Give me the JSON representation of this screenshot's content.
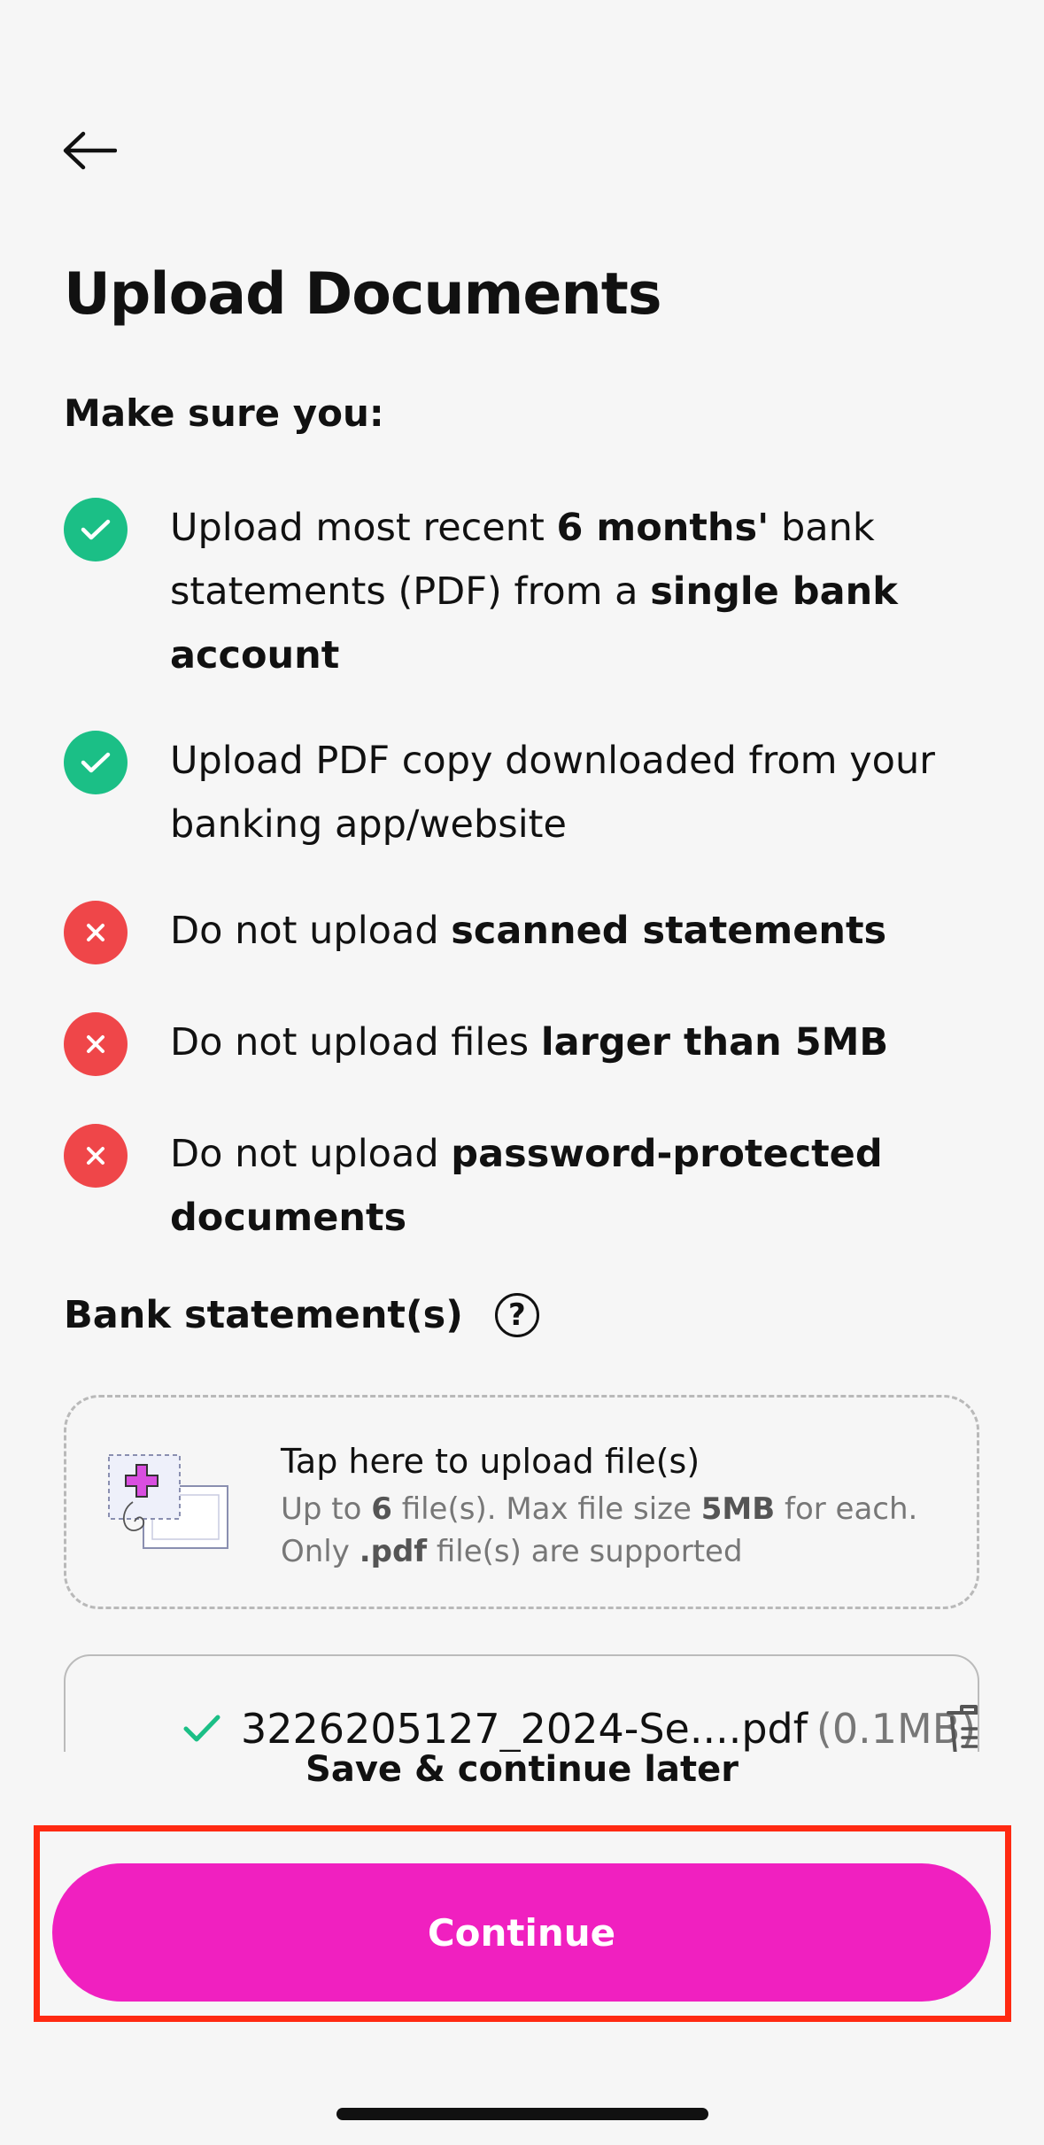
{
  "colors": {
    "background": "#f6f6f6",
    "accent": "#f020c0",
    "success": "#1bbf86",
    "danger": "#ef4649",
    "highlight": "#ff2a12"
  },
  "header": {
    "back_icon": "arrow-left-icon",
    "title": "Upload Documents"
  },
  "requirements": {
    "heading": "Make sure you:",
    "items": [
      {
        "type": "do",
        "icon": "check-circle-icon",
        "parts": [
          {
            "t": "Upload most recent "
          },
          {
            "b": "6 months'"
          },
          {
            "t": " bank statements (PDF) from a "
          },
          {
            "b": "single bank account"
          }
        ]
      },
      {
        "type": "do",
        "icon": "check-circle-icon",
        "parts": [
          {
            "t": "Upload PDF copy downloaded from your banking app/website"
          }
        ]
      },
      {
        "type": "dont",
        "icon": "x-circle-icon",
        "parts": [
          {
            "t": "Do not upload "
          },
          {
            "b": "scanned statements"
          }
        ]
      },
      {
        "type": "dont",
        "icon": "x-circle-icon",
        "parts": [
          {
            "t": "Do not upload files "
          },
          {
            "b": "larger than 5MB"
          }
        ]
      },
      {
        "type": "dont",
        "icon": "x-circle-icon",
        "parts": [
          {
            "t": "Do not upload "
          },
          {
            "b": "password-protected documents"
          }
        ]
      }
    ]
  },
  "bank_statements": {
    "label": "Bank statement(s)",
    "help_icon": "question-circle-icon",
    "help_symbol": "?",
    "upload": {
      "title": "Tap here to upload file(s)",
      "desc_parts": [
        {
          "t": "Up to "
        },
        {
          "b": "6"
        },
        {
          "t": " file(s). Max file size "
        },
        {
          "b": "5MB"
        },
        {
          "t": " for each. Only "
        },
        {
          "b": ".pdf"
        },
        {
          "t": " file(s) are supported"
        }
      ]
    },
    "files": [
      {
        "name": "3226205127_2024-Se....pdf",
        "size": "(0.1MB)",
        "status_icon": "check-icon",
        "delete_icon": "trash-icon"
      }
    ]
  },
  "footer": {
    "save_later": "Save & continue later",
    "continue": "Continue"
  }
}
